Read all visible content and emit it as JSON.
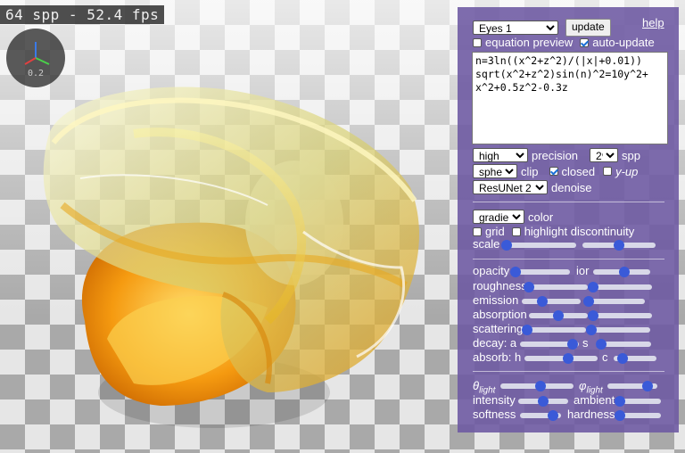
{
  "stats": {
    "text": "64 spp - 52.4 fps"
  },
  "axes": {
    "label": "0.2"
  },
  "panel": {
    "preset": "Eyes 1",
    "update_label": "update",
    "help_label": "help",
    "equation_preview": {
      "label": "equation preview",
      "checked": false
    },
    "auto_update": {
      "label": "auto-update",
      "checked": true
    },
    "equation": "n=3ln((x^2+z^2)/(|x|+0.01))\nsqrt(x^2+z^2)sin(n)^2=10y^2+\nx^2+0.5z^2-0.3z",
    "precision": {
      "value": "high",
      "label": "precision"
    },
    "spp": {
      "value": "2⁶",
      "label": "spp"
    },
    "clip": {
      "value": "sphere",
      "label": "clip"
    },
    "closed": {
      "label": "closed",
      "checked": true
    },
    "yup": {
      "label": "y-up",
      "checked": false
    },
    "denoise": {
      "value": "ResUNet 2",
      "label": "denoise"
    },
    "color": {
      "value": "gradient",
      "label": "color"
    },
    "grid": {
      "label": "grid",
      "checked": false
    },
    "highlight": {
      "label": "highlight discontinuity",
      "checked": false
    },
    "scale_label": "scale",
    "material_labels": {
      "opacity": "opacity",
      "ior": "ior",
      "roughness": "roughness",
      "emission": "emission",
      "absorption": "absorption",
      "scattering": "scattering",
      "decay": "decay: a",
      "s": "s",
      "absorb": "absorb: h",
      "c": "c"
    },
    "light_labels": {
      "theta": "θ",
      "theta_sub": "light",
      "phi": "φ",
      "phi_sub": "light",
      "intensity": "intensity",
      "ambient": "ambient",
      "softness": "softness",
      "hardness": "hardness"
    },
    "slider_values": {
      "scale_a": 0.0,
      "scale_b": 0.5,
      "opacity": 0.05,
      "ior": 0.55,
      "roughness_a": 0.0,
      "roughness_b": 0.0,
      "emission_a": 0.35,
      "emission_b": 0.05,
      "absorption_a": 0.5,
      "absorption_b": 0.0,
      "scattering_a": 0.0,
      "scattering_b": 0.0,
      "decay_a": 0.9,
      "decay_b": 0.1,
      "absorb_h": 0.6,
      "absorb_c": 0.2,
      "theta": 0.55,
      "phi": 0.8,
      "intensity": 0.5,
      "ambient": 0.0,
      "softness": 0.8,
      "hardness": 0.0
    }
  },
  "colors": {
    "panel": "#6c58a2",
    "knob": "#3a5ad8",
    "accent_orange": "#f0a020",
    "accent_yellow": "#f4e060"
  }
}
